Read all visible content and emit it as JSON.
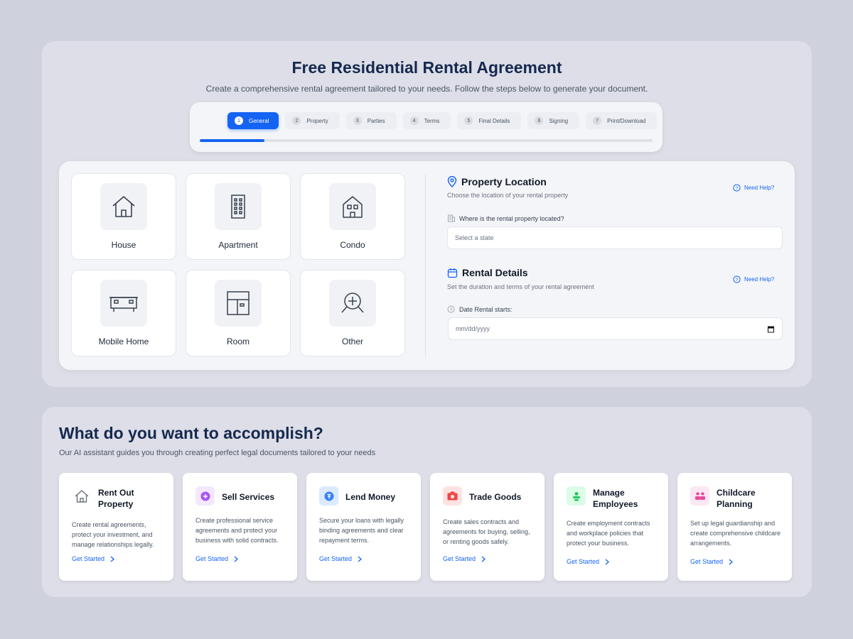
{
  "header": {
    "title": "Free Residential Rental Agreement",
    "subtitle": "Create a comprehensive rental agreement tailored to your needs. Follow the steps below to generate your document."
  },
  "steps": [
    {
      "num": "1",
      "label": "General",
      "active": true
    },
    {
      "num": "2",
      "label": "Property"
    },
    {
      "num": "3",
      "label": "Parties"
    },
    {
      "num": "4",
      "label": "Terms"
    },
    {
      "num": "5",
      "label": "Final Details"
    },
    {
      "num": "6",
      "label": "Signing"
    },
    {
      "num": "7",
      "label": "Print/Download"
    }
  ],
  "progress": {
    "value": 0.143
  },
  "property_types": [
    {
      "label": "House",
      "icon": "house-icon"
    },
    {
      "label": "Apartment",
      "icon": "apartment-icon"
    },
    {
      "label": "Condo",
      "icon": "condo-icon"
    },
    {
      "label": "Mobile Home",
      "icon": "mobile-home-icon"
    },
    {
      "label": "Room",
      "icon": "room-icon"
    },
    {
      "label": "Other",
      "icon": "other-icon"
    }
  ],
  "location": {
    "title": "Property Location",
    "description": "Choose the location of your rental property",
    "help": "Need Help?",
    "field_label": "Where is the rental property located?",
    "placeholder": "Select a state"
  },
  "rental": {
    "title": "Rental Details",
    "description": "Set the duration and terms of your rental agreement",
    "help": "Need Help?",
    "field_label": "Date Rental starts:",
    "placeholder": "mm/dd/yyyy"
  },
  "accomplish": {
    "title": "What do you want to accomplish?",
    "subtitle": "Our AI assistant guides you through creating perfect legal documents tailored to your needs",
    "cards": [
      {
        "title": "Rent Out Property",
        "desc": "Create rental agreements, protect your investment, and manage relationships legally.",
        "link": "Get Started",
        "icon": "house-icon",
        "color": "#6b7280",
        "bg": "#ffffff"
      },
      {
        "title": "Sell Services",
        "desc": "Create professional service agreements and protect your business with solid contracts.",
        "link": "Get Started",
        "icon": "plus-circle-icon",
        "color": "#a855f7",
        "bg": "#f3e8ff"
      },
      {
        "title": "Lend Money",
        "desc": "Secure your loans with legally binding agreements and clear repayment terms.",
        "link": "Get Started",
        "icon": "money-icon",
        "color": "#3b82f6",
        "bg": "#dbeafe"
      },
      {
        "title": "Trade Goods",
        "desc": "Create sales contracts and agreements for buying, selling, or renting goods safely.",
        "link": "Get Started",
        "icon": "camera-icon",
        "color": "#ef4444",
        "bg": "#fee2e2"
      },
      {
        "title": "Manage Employees",
        "desc": "Create employment contracts and workplace policies that protect your business.",
        "link": "Get Started",
        "icon": "employee-icon",
        "color": "#22c55e",
        "bg": "#dcfce7"
      },
      {
        "title": "Childcare Planning",
        "desc": "Set up legal guardianship and create comprehensive childcare arrangements.",
        "link": "Get Started",
        "icon": "family-icon",
        "color": "#ec4899",
        "bg": "#fce7f3"
      }
    ]
  },
  "colors": {
    "accent": "#1463f3",
    "heading": "#16284f"
  }
}
